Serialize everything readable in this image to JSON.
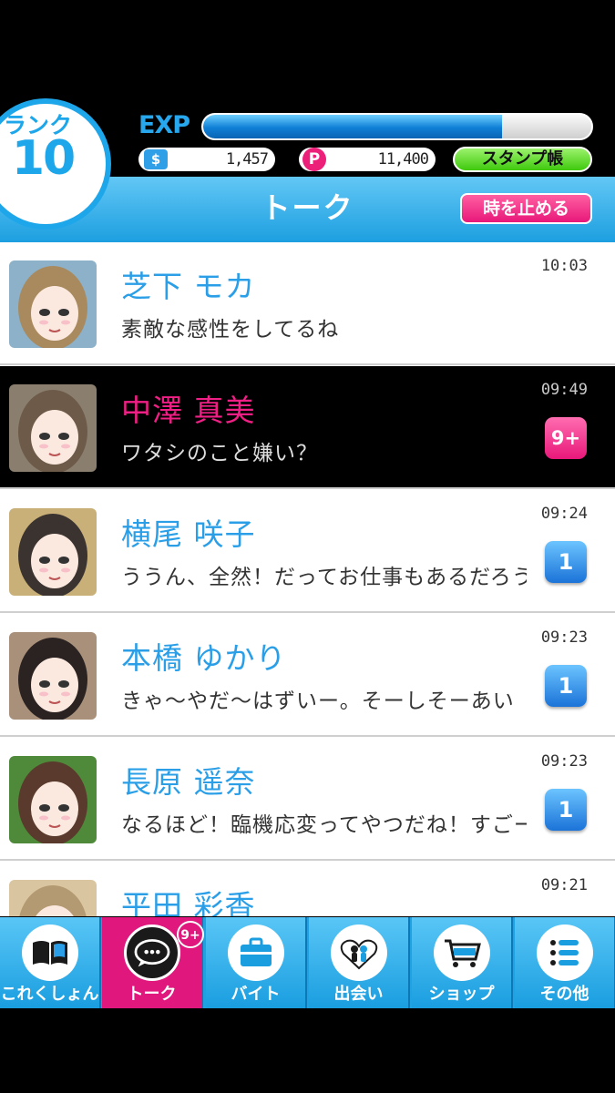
{
  "header": {
    "rank_label": "ランク",
    "rank_value": "10",
    "exp_label": "EXP",
    "exp_fraction": 0.77,
    "money_icon": "money-icon",
    "money_value": "1,457",
    "points_icon": "points-icon",
    "points_symbol": "P",
    "points_value": "11,400",
    "stamp_book_label": "スタンプ帳",
    "title": "トーク",
    "stop_time_label": "時を止める"
  },
  "talks": [
    {
      "name": "芝下 モカ",
      "message": "素敵な感性をしてるね",
      "time": "10:03",
      "badge": ""
    },
    {
      "name": "中澤 真美",
      "message": "ワタシのこと嫌い？",
      "time": "09:49",
      "badge": "9+"
    },
    {
      "name": "横尾 咲子",
      "message": "ううん、全然！だってお仕事もあるだろう",
      "time": "09:24",
      "badge": "1"
    },
    {
      "name": "本橋 ゆかり",
      "message": "きゃ～やだ～はずいー。そーしそーあい",
      "time": "09:23",
      "badge": "1"
    },
    {
      "name": "長原 遥奈",
      "message": "なるほど！臨機応変ってやつだね！すごー",
      "time": "09:23",
      "badge": "1"
    },
    {
      "name": "平田 彩香",
      "message": "",
      "time": "09:21",
      "badge": ""
    }
  ],
  "nav": [
    {
      "label": "これくしょん",
      "icon": "book-icon"
    },
    {
      "label": "トーク",
      "icon": "chat-bubble-icon",
      "badge": "9+"
    },
    {
      "label": "バイト",
      "icon": "briefcase-icon"
    },
    {
      "label": "出会い",
      "icon": "heart-people-icon"
    },
    {
      "label": "ショップ",
      "icon": "cart-icon"
    },
    {
      "label": "その他",
      "icon": "menu-list-icon"
    }
  ],
  "colors": {
    "accent_blue": "#1ea6ea",
    "accent_pink": "#e0177d",
    "stamp_green": "#3fc90d"
  }
}
